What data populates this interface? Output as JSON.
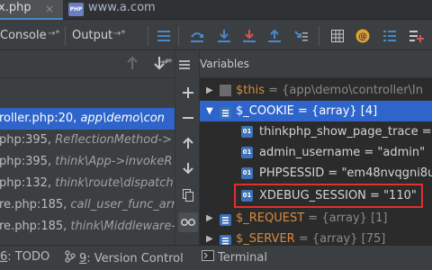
{
  "tabs": [
    {
      "label": "x.php",
      "close": "×"
    },
    {
      "badge": "PHP",
      "label": "www.a.com"
    }
  ],
  "toolbar": {
    "console_label": "Console",
    "output_label": "Output"
  },
  "frames": [
    {
      "loc": "roller.php:20,",
      "method": "app\\demo\\con",
      "selected": true
    },
    {
      "loc": "php:395,",
      "method": "ReflectionMethod->",
      "selected": false
    },
    {
      "loc": "php:395,",
      "method": "think\\App->invokeR",
      "selected": false
    },
    {
      "loc": "php:132,",
      "method": "think\\route\\dispatch\\M",
      "selected": false
    },
    {
      "loc": "re.php:185,",
      "method": "call_user_func_arra",
      "selected": false
    },
    {
      "loc": "re.php:185,",
      "method": "think\\Middleware-",
      "selected": false
    }
  ],
  "variables": {
    "header": "Variables",
    "rows": [
      {
        "name": "$this",
        "value": " = {app\\demo\\controller\\In",
        "kind": "object",
        "expanded": false
      },
      {
        "name": "$_COOKIE",
        "value": " = {array} [4]",
        "kind": "array",
        "expanded": true
      },
      {
        "name": "thinkphp_show_page_trace",
        "value": " = ",
        "kind": "string-child"
      },
      {
        "name": "admin_username",
        "value": " = \"admin\"",
        "kind": "string-child"
      },
      {
        "name": "PHPSESSID",
        "value": " = \"em48nvqgni8u",
        "kind": "string-child"
      },
      {
        "name": "XDEBUG_SESSION",
        "value": " = \"110\"",
        "kind": "string-child"
      },
      {
        "name": "$_REQUEST",
        "value": " = {array} [1]",
        "kind": "array",
        "expanded": false
      },
      {
        "name": "$_SERVER",
        "value": " = {array} [75]",
        "kind": "array",
        "expanded": false
      }
    ]
  },
  "statusbar": {
    "todo_num": "6",
    "todo_label": ": TODO",
    "vc_num": "9",
    "vc_label": ": Version Control",
    "terminal_label": "Terminal"
  },
  "colors": {
    "selection": "#2f65ca",
    "highlight_box": "#e03030",
    "var_name": "#d68a3e"
  }
}
